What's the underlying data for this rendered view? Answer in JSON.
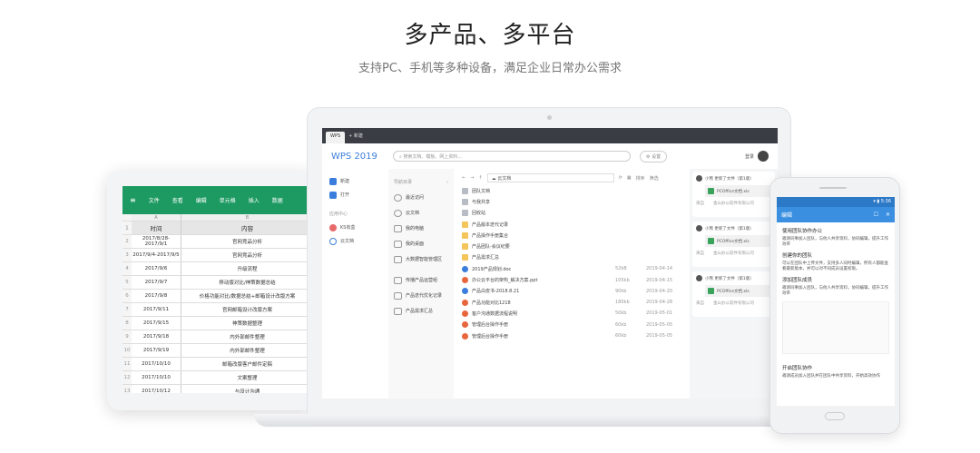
{
  "header": {
    "title": "多产品、多平台",
    "subtitle": "支持PC、手机等多种设备，满足企业日常办公需求"
  },
  "tablet": {
    "menu": [
      "文件",
      "查看",
      "编辑",
      "单元格",
      "插入",
      "数据"
    ],
    "col_letters": [
      "A",
      "B"
    ],
    "headers": [
      "时间",
      "内容"
    ],
    "rows": [
      [
        "2",
        "2017/8/28-2017/9/1",
        "官网竞品分析"
      ],
      [
        "3",
        "2017/9/4-2017/9/5",
        "官网竞品分析"
      ],
      [
        "4",
        "2017/9/6",
        "升级流程"
      ],
      [
        "5",
        "2017/9/7",
        "移动版对比/神策数据总结"
      ],
      [
        "6",
        "2017/9/8",
        "价格功能对比/数据总结+邮箱设计改版方案"
      ],
      [
        "7",
        "2017/9/11",
        "官网邮箱设计改版方案"
      ],
      [
        "8",
        "2017/9/15",
        "神策数据整理"
      ],
      [
        "9",
        "2017/9/18",
        "内外部邮件整理"
      ],
      [
        "10",
        "2017/9/19",
        "内外部邮件整理"
      ],
      [
        "11",
        "2017/10/10",
        "邮箱改版客户邮件定稿"
      ],
      [
        "12",
        "2017/10/10",
        "文案整理"
      ],
      [
        "13",
        "2017/10/12",
        "与设计沟通"
      ]
    ]
  },
  "laptop": {
    "tabs": {
      "home": "WPS",
      "new": "新建"
    },
    "brand": "WPS 2019",
    "search_placeholder": "搜索文档、模板、网上资料...",
    "settings": "设置",
    "user": "登录",
    "side": {
      "new": "新建",
      "open": "打开",
      "group_label": "应用中心",
      "cloud": "KS有盒",
      "public": "云文档"
    },
    "nav_title": "导航目录",
    "nav": [
      "最近访问",
      "云文档",
      "我的电脑",
      "我的桌面",
      "大数据智能管理区",
      "传播产品运营组",
      "产品迭代优化记录",
      "产品需求汇总"
    ],
    "path": "云文档",
    "toolbar": {
      "sort": "排序",
      "filter": "筛选"
    },
    "files": [
      {
        "name": "团队文档",
        "type": "team"
      },
      {
        "name": "与我共享",
        "type": "team"
      },
      {
        "name": "回收站",
        "type": "team"
      },
      {
        "name": "产品版本迭代记录",
        "type": "folder"
      },
      {
        "name": "产品操作手册集合",
        "type": "folder"
      },
      {
        "name": "产品团队-会议纪要",
        "type": "folder"
      },
      {
        "name": "产品需求汇总",
        "type": "folder"
      },
      {
        "name": "2019产品规划.doc",
        "type": "doc",
        "size": "52kB",
        "date": "2019-04-14"
      },
      {
        "name": "办公云平台的架构_解决方案.ppt",
        "type": "ppt",
        "size": "105kb",
        "date": "2019-04-15"
      },
      {
        "name": "产品白皮书-2018.8.21",
        "type": "doc",
        "size": "90kb",
        "date": "2019-04-20"
      },
      {
        "name": "产品功能对比1218",
        "type": "ppt",
        "size": "180kb",
        "date": "2019-04-28"
      },
      {
        "name": "客户沟通数据流程说明",
        "type": "ppt",
        "size": "50kb",
        "date": "2019-05-01"
      },
      {
        "name": "管理后台操作手册",
        "type": "ppt",
        "size": "60kb",
        "date": "2019-05-05"
      },
      {
        "name": "管理后台操作手册",
        "type": "ppt",
        "size": "60kb",
        "date": "2019-05-05"
      }
    ],
    "feed": [
      {
        "who": "小熊 更新了文件（第1版）",
        "file": "PCOffice文档.xls",
        "from": "来自",
        "org": "金山办公软件有限公司"
      },
      {
        "who": "小熊 更新了文件（第1版）",
        "file": "PCOffice文档.xls",
        "from": "来自",
        "org": "金山办公软件有限公司"
      },
      {
        "who": "小熊 更新了文件（第1版）",
        "file": "PCOffice文档.xls",
        "from": "来自",
        "org": "金山办公软件有限公司"
      }
    ]
  },
  "phone": {
    "time": "5:36",
    "title": "编辑",
    "sections": [
      {
        "h": "使用团队协作办公",
        "p": "邀请同事加入团队，与他人共享资料，协同编辑，提升工作效率"
      },
      {
        "h": "创建你的团队",
        "p": "可以在团队中上传文件，支持多人同时编辑，所有人都能查看最新版本，并可以对不同成员设置权限。"
      },
      {
        "h": "添加团队成员",
        "p": "邀请同事加入团队，与他人共享资料，协同编辑，提升工作效率"
      },
      {
        "h": "开启团队协作",
        "p": "邀请成员加入团队并在团队中共享资料，开始高效协作"
      }
    ]
  },
  "colors": {
    "sheet_green": "#1d9a62",
    "wps_blue": "#3b7ddd",
    "phone_blue": "#3a8fe0",
    "folder": "#f4c55b",
    "doc": "#3b7ddd",
    "ppt": "#e8663d"
  }
}
